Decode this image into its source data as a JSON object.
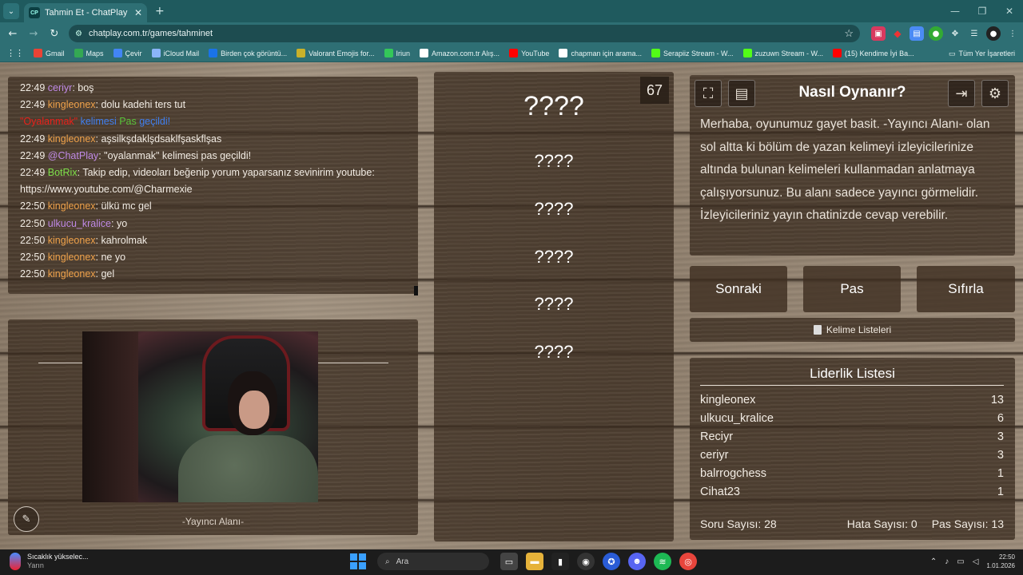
{
  "browser": {
    "tab_title": "Tahmin Et - ChatPlay",
    "tab_favicon": "CP",
    "url": "chatplay.com.tr/games/tahminet",
    "bookmarks": [
      {
        "label": "Gmail",
        "color": "#ea4335"
      },
      {
        "label": "Maps",
        "color": "#34a853"
      },
      {
        "label": "Çevir",
        "color": "#4285f4"
      },
      {
        "label": "iCloud Mail",
        "color": "#8ab4f8"
      },
      {
        "label": "Birden çok görüntü...",
        "color": "#1a73e8"
      },
      {
        "label": "Valorant Emojis for...",
        "color": "#c9b12a"
      },
      {
        "label": "Iriun",
        "color": "#34c759"
      },
      {
        "label": "Amazon.com.tr Alış...",
        "color": "#ffffff"
      },
      {
        "label": "YouTube",
        "color": "#ff0000"
      },
      {
        "label": "chapman için arama...",
        "color": "#ffffff"
      },
      {
        "label": "Serapiiz Stream - W...",
        "color": "#53fc18"
      },
      {
        "label": "zuzuwn Stream - W...",
        "color": "#53fc18"
      },
      {
        "label": "(15) Kendime İyi Ba...",
        "color": "#ff0000"
      }
    ],
    "all_bookmarks": "Tüm Yer İşaretleri"
  },
  "chat": {
    "messages": [
      {
        "time": "22:49",
        "user": "ceriyr",
        "sep": ": ",
        "text": "boş",
        "color": "#c08ae6"
      },
      {
        "time": "22:49",
        "user": "kingleonex",
        "sep": ": ",
        "text": "dolu kadehi ters tut",
        "color": "#f0a24a"
      },
      {
        "time": "",
        "user": "\"Oyalanmak\"",
        "sep": " ",
        "text": "",
        "color": "#e8201a",
        "special": true
      },
      {
        "time": "22:49",
        "user": "kingleonex",
        "sep": ": ",
        "text": "aşsilkşdaklşdsaklfşaskflşas",
        "color": "#f0a24a"
      },
      {
        "time": "22:49",
        "user": "@ChatPlay",
        "sep": ": ",
        "text": "\"oyalanmak\" kelimesi pas geçildi!",
        "color": "#c08ae6"
      },
      {
        "time": "22:49",
        "user": "BotRix",
        "sep": ": ",
        "text": "Takip edip, videoları beğenip yorum yaparsanız sevinirim youtube: https://www.youtube.com/@Charmexie",
        "color": "#7ee04a",
        "wrap": true
      },
      {
        "time": "22:50",
        "user": "kingleonex",
        "sep": ": ",
        "text": "ülkü mc gel",
        "color": "#f0a24a"
      },
      {
        "time": "22:50",
        "user": "ulkucu_kralice",
        "sep": ": ",
        "text": "yo",
        "color": "#c08ae6"
      },
      {
        "time": "22:50",
        "user": "kingleonex",
        "sep": ": ",
        "text": "kahrolmak",
        "color": "#f0a24a"
      },
      {
        "time": "22:50",
        "user": "kingleonex",
        "sep": ": ",
        "text": "ne yo",
        "color": "#f0a24a"
      },
      {
        "time": "22:50",
        "user": "kingleonex",
        "sep": ": ",
        "text": "gel",
        "color": "#f0a24a"
      }
    ],
    "pass_notice": {
      "word": "\"Oyalanmak\"",
      "w1": " kelimesi ",
      "w2": "Pas",
      "w3": " geçildi!"
    }
  },
  "streamer": {
    "label": "-Yayıncı Alanı-"
  },
  "words": {
    "timer": "67",
    "main": "????",
    "list": [
      "????",
      "????",
      "????",
      "????",
      "????"
    ]
  },
  "howto": {
    "title": "Nasıl Oynanır?",
    "description": "Merhaba, oyunumuz gayet basit. -Yayıncı Alanı- olan sol altta ki bölüm de yazan kelimeyi izleyicilerinize altında bulunan kelimeleri kullanmadan anlatmaya çalışıyorsunuz. Bu alanı sadece yayıncı görmelidir. İzleyicileriniz yayın chatinizde cevap verebilir."
  },
  "controls": {
    "next": "Sonraki",
    "pass": "Pas",
    "reset": "Sıfırla",
    "word_lists": "Kelime Listeleri"
  },
  "leaderboard": {
    "title": "Liderlik Listesi",
    "rows": [
      {
        "name": "kingleonex",
        "score": "13"
      },
      {
        "name": "ulkucu_kralice",
        "score": "6"
      },
      {
        "name": "Reciyr",
        "score": "3"
      },
      {
        "name": "ceriyr",
        "score": "3"
      },
      {
        "name": "balrrogchess",
        "score": "1"
      },
      {
        "name": "Cihat23",
        "score": "1"
      }
    ],
    "question_count": "Soru Sayısı: 28",
    "error_count": "Hata Sayısı: 0",
    "pass_count": "Pas Sayısı: 13"
  },
  "taskbar": {
    "weather_title": "Sıcaklık yükselec...",
    "weather_sub": "Yarın",
    "search": "Ara",
    "time": "22:50",
    "date": "1.01.2026"
  }
}
